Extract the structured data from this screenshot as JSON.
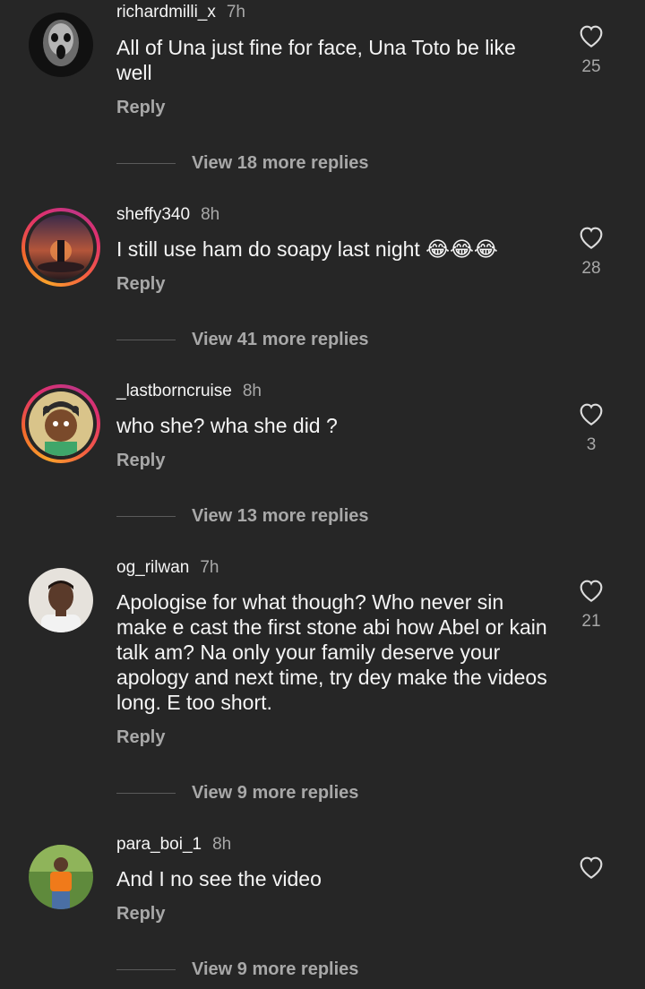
{
  "comments": [
    {
      "username": "richardmilli_x",
      "time": "7h",
      "text": "All of Una just fine for face, Una Toto be like well",
      "reply_label": "Reply",
      "likes": "25",
      "view_replies": "View 18 more replies",
      "avatar": "dark-skull-avatar",
      "story_ring": false
    },
    {
      "username": "sheffy340",
      "time": "8h",
      "text": "I still use ham do soapy last night 😂😂😂",
      "reply_label": "Reply",
      "likes": "28",
      "view_replies": "View 41 more replies",
      "avatar": "sunset-figure-avatar",
      "story_ring": true
    },
    {
      "username": "_lastborncruise",
      "time": "8h",
      "text": "who she? wha she did ?",
      "reply_label": "Reply",
      "likes": "3",
      "view_replies": "View 13 more replies",
      "avatar": "cartoon-avatar",
      "story_ring": true
    },
    {
      "username": "og_rilwan",
      "time": "7h",
      "text": "Apologise for what though? Who never sin make e cast the first stone abi how Abel or kain talk am? Na only your family deserve your apology and next time, try dey make the videos long. E too short.",
      "reply_label": "Reply",
      "likes": "21",
      "view_replies": "View 9 more replies",
      "avatar": "man-portrait-avatar",
      "story_ring": false
    },
    {
      "username": "para_boi_1",
      "time": "8h",
      "text": "And I no see the video",
      "reply_label": "Reply",
      "likes": "",
      "view_replies": "View 9 more replies",
      "avatar": "orange-shirt-avatar",
      "story_ring": false
    }
  ],
  "colors": {
    "background": "#262626",
    "primary_text": "#f5f5f5",
    "secondary_text": "#a8a8a8"
  }
}
